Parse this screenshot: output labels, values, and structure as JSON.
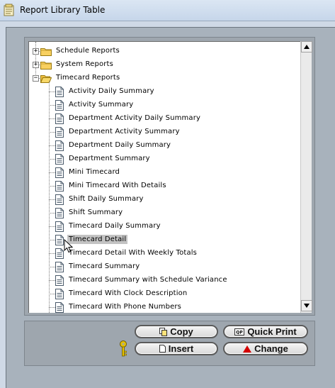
{
  "window": {
    "title": "Report Library Table",
    "icon": "report-library-icon"
  },
  "tree": {
    "folders": [
      {
        "label": "Schedule Reports",
        "expanded": false
      },
      {
        "label": "System Reports",
        "expanded": false
      },
      {
        "label": "Timecard Reports",
        "expanded": true
      }
    ],
    "items": [
      {
        "label": "Activity Daily Summary"
      },
      {
        "label": "Activity Summary"
      },
      {
        "label": "Department Activity Daily Summary"
      },
      {
        "label": "Department Activity Summary"
      },
      {
        "label": "Department Daily Summary"
      },
      {
        "label": "Department Summary"
      },
      {
        "label": "Mini Timecard"
      },
      {
        "label": "Mini Timecard With Details"
      },
      {
        "label": "Shift Daily Summary"
      },
      {
        "label": "Shift Summary"
      },
      {
        "label": "Timecard Daily Summary"
      },
      {
        "label": "Timecard Detail",
        "selected": true
      },
      {
        "label": "Timecard Detail With Weekly Totals"
      },
      {
        "label": "Timecard Summary"
      },
      {
        "label": "Timecard Summary with Schedule Variance"
      },
      {
        "label": "Timecard With Clock Description"
      },
      {
        "label": "Timecard With Phone Numbers"
      }
    ]
  },
  "buttons": {
    "copy": "Copy",
    "quick_print": "Quick Print",
    "quick_print_badge": "QP",
    "insert": "Insert",
    "change": "Change"
  },
  "colors": {
    "selected_row": "#c3c3c3",
    "change_accent": "#d40000",
    "key_icon": "#e5c000"
  }
}
